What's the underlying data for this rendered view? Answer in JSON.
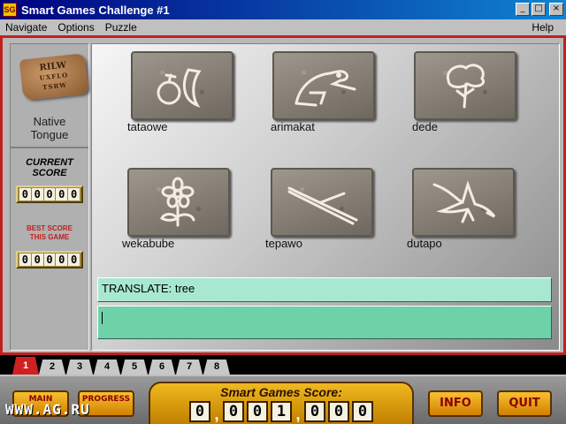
{
  "window": {
    "title": "Smart Games Challenge #1",
    "icon": "smart-games-icon",
    "icon_glyph": "SG",
    "min": "_",
    "max": "□",
    "close": "×"
  },
  "menu": {
    "items": [
      "Navigate",
      "Options",
      "Puzzle"
    ],
    "help": "Help"
  },
  "sidebar": {
    "sign_lines": [
      "RILW",
      "UXFLO",
      "TSRW"
    ],
    "puzzle_name": [
      "Native",
      "Tongue"
    ],
    "current_score_label": [
      "CURRENT",
      "SCORE"
    ],
    "current_score_digits": [
      "0",
      "0",
      "0",
      "0",
      "0"
    ],
    "best_score_label": [
      "BEST SCORE",
      "THIS GAME"
    ],
    "best_score_digits": [
      "0",
      "0",
      "0",
      "0",
      "0"
    ]
  },
  "cards": [
    {
      "word": "tataowe",
      "picture": "fruit-icon"
    },
    {
      "word": "arimakat",
      "picture": "beaver-icon"
    },
    {
      "word": "dede",
      "picture": "tree-icon"
    },
    {
      "word": "wekabube",
      "picture": "flower-icon"
    },
    {
      "word": "tepawo",
      "picture": "stick-icon"
    },
    {
      "word": "dutapo",
      "picture": "bird-icon"
    }
  ],
  "prompt": "TRANSLATE: tree",
  "answer": {
    "value": ""
  },
  "tabs": [
    "1",
    "2",
    "3",
    "4",
    "5",
    "6",
    "7",
    "8"
  ],
  "active_tab": 0,
  "bottom": {
    "main_label": "MAIN",
    "progress_label": "PROGRESS",
    "score_title": "Smart Games Score:",
    "score_groups": [
      [
        "0"
      ],
      [
        "0",
        "0",
        "1"
      ],
      [
        "0",
        "0",
        "0"
      ]
    ],
    "separator": ",",
    "info_label": "INFO",
    "quit_label": "QUIT"
  },
  "watermark": "WWW.AG.RU",
  "colors": {
    "frame_red": "#c02020",
    "translate_bg": "#a8e8d0",
    "input_bg": "#6ed2a8",
    "gold": "#f0b820"
  }
}
